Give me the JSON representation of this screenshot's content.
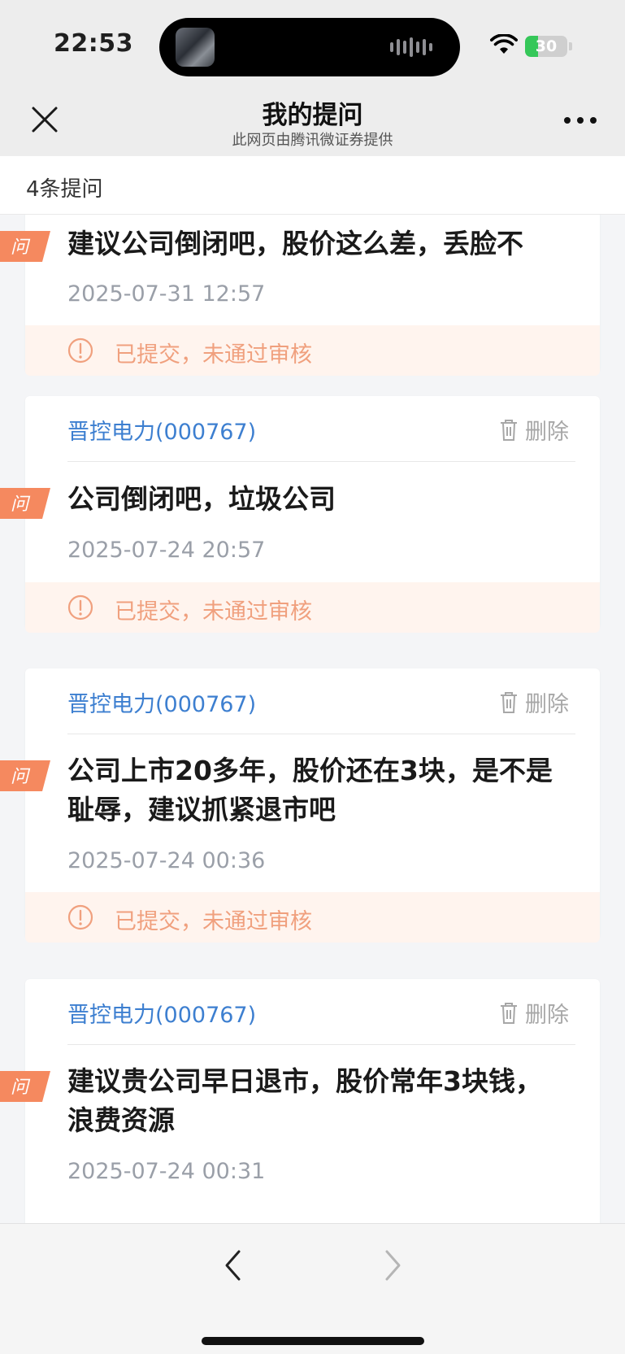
{
  "status_bar": {
    "time": "22:53",
    "battery_level": "30",
    "battery_fraction": 0.3
  },
  "nav": {
    "title": "我的提问",
    "subtitle": "此网页由腾讯微证券提供"
  },
  "list": {
    "count_label": "4条提问",
    "badge_label": "问",
    "delete_label": "删除",
    "items": [
      {
        "stock": "",
        "question": "建议公司倒闭吧，股价这么差，丢脸不",
        "time": "2025-07-31 12:57",
        "status": "已提交，未通过审核"
      },
      {
        "stock": "晋控电力(000767)",
        "question": "公司倒闭吧，垃圾公司",
        "time": "2025-07-24 20:57",
        "status": "已提交，未通过审核"
      },
      {
        "stock": "晋控电力(000767)",
        "question": "公司上市20多年，股价还在3块，是不是耻辱，建议抓紧退市吧",
        "time": "2025-07-24 00:36",
        "status": "已提交，未通过审核"
      },
      {
        "stock": "晋控电力(000767)",
        "question": "建议贵公司早日退市，股价常年3块钱，浪费资源",
        "time": "2025-07-24 00:31",
        "status": ""
      }
    ]
  },
  "colors": {
    "stock_link": "#3d7fd0",
    "badge": "#f5895f",
    "status_text": "#f0a07e",
    "status_bg": "#fff4ee"
  },
  "icons": [
    "wifi-icon",
    "battery-icon",
    "close-icon",
    "more-icon",
    "trash-icon",
    "warning-icon",
    "chevron-left-icon",
    "chevron-right-icon"
  ]
}
